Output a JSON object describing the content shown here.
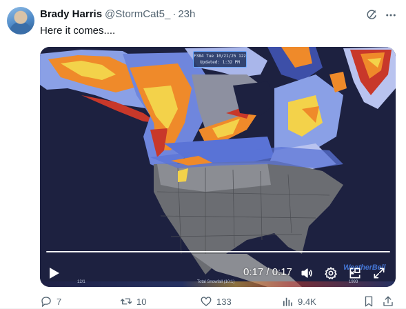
{
  "tweet": {
    "author_name": "Brady Harris",
    "handle": "@StormCat5_",
    "separator": "·",
    "time": "23h",
    "text": "Here it comes...."
  },
  "media": {
    "stamp_line1": "F384 Tue 10/21/25 12z",
    "stamp_line2": "Updated: 1:32 PM",
    "brand": "WeatherBell",
    "legend_left": "12/1",
    "legend_mid": "Total Snowfall (10:1)",
    "legend_right": "1993",
    "video": {
      "time_readout": "0:17 / 0:17",
      "progress": 1.0
    }
  },
  "actions": {
    "replies": "7",
    "reposts": "10",
    "likes": "133",
    "views": "9.4K"
  },
  "icons": {
    "grok": "grok-icon",
    "more": "more-icon",
    "play": "play-icon",
    "volume": "volume-icon",
    "settings": "gear-icon",
    "pip": "picture-in-picture-icon",
    "fullscreen": "fullscreen-icon",
    "reply": "reply-icon",
    "repost": "repost-icon",
    "like": "heart-icon",
    "views": "views-icon",
    "bookmark": "bookmark-icon",
    "share": "share-icon"
  },
  "colors": {
    "text_primary": "#0f1419",
    "text_secondary": "#536471",
    "map_background": "#1d2140",
    "land_gray": "#6b6d72",
    "snow_light": "#b9c3ef",
    "snow_mid": "#5a73d6",
    "snow_heavy_orange": "#ef8a2a",
    "snow_yellow": "#f3d24a",
    "snow_red": "#c8382a",
    "brand_blue": "#4f8dff"
  }
}
